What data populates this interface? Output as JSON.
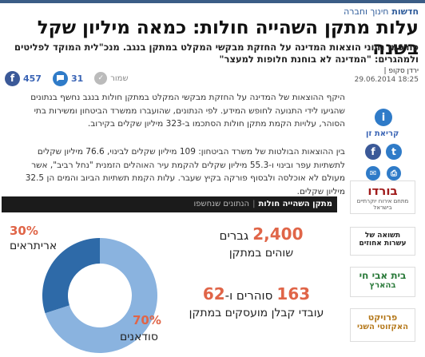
{
  "breadcrumb": {
    "section": "חדשות",
    "subsection": "חינוך וחברה"
  },
  "headline": "עלות מתקן השהייה חולות: כמאה מיליון שקל בשנה",
  "subheadline": "פורסמו נתוני הוצאות המדינה על החזקת מבקשי המקלט במתקן בנגב. מנכ\"לית המוקד לפליטים ולמהגרים: \"המדינה לא בוחנת חלופות למעצר\"",
  "author": {
    "name": "ירדן סקופ |",
    "date": "18:25 29.06.2014"
  },
  "share": {
    "facebook_count": "457",
    "comments_count": "31",
    "save_label": "שמור"
  },
  "paragraphs": [
    "היקף ההוצאות של המדינה על החזקת מבקשי המקלט במתקן חולות בנגב נחשף בנתונים שהגיעו לידי התנועה לחופש המידע. לפי הנתונים, שהועברו ממשרד הביטחון ומשירות בתי הסוהר, עלויות הקמת מתקן חולות הסתכמו ב-323 מיליון שקלים בקירוב.",
    "בין ההוצאות הבולטות של משרד הביטחון: 109 מיליון שקלים לבינוי, 76.6 מיליון שקלים לתשתיות עפר ובינוי ו-55.3 מיליון שקלים להקמת עיר האוהלים הזמנית \"נחל רביב\", אשר מעולם לא אוכלסה ולבסוף פורקה בקיץ שעבר. עלות הקמת תשתיות הביוב והמים הן 32.5 מיליון שקלים."
  ],
  "sidebar": {
    "read_label": "קריאת זן",
    "logos": [
      {
        "text1": "בורדו",
        "text2": "מתחם אירוח יוקרתיים בישראל"
      },
      {
        "text1": "תשואה של",
        "text2": "עשרות אחוזים"
      },
      {
        "text1": "בית אבי חי",
        "text2": "בהארץ"
      },
      {
        "text1": "פרויקט",
        "text2": "האקזוטי השני"
      }
    ]
  },
  "infographic": {
    "header_title": "מתקן השהייה חולות",
    "header_sub": "הנתונים שנחשפו",
    "stat1": {
      "number": "2,400",
      "unit": "גברים",
      "line2": "שוהים במתקן"
    },
    "stat2": {
      "number1": "163",
      "mid": "סוהרים ו-",
      "number2": "62",
      "line2": "עובדי קבלן מועסקים במתקן"
    },
    "pct_eritrea": "30%",
    "label_eritrea": "אריתראים",
    "pct_sudan": "70%",
    "label_sudan": "סודאנים"
  },
  "chart_data": {
    "type": "pie",
    "categories": [
      "אריתראים",
      "סודאנים"
    ],
    "values": [
      30,
      70
    ],
    "colors": [
      "#2e6aa8",
      "#8ab3df"
    ]
  }
}
